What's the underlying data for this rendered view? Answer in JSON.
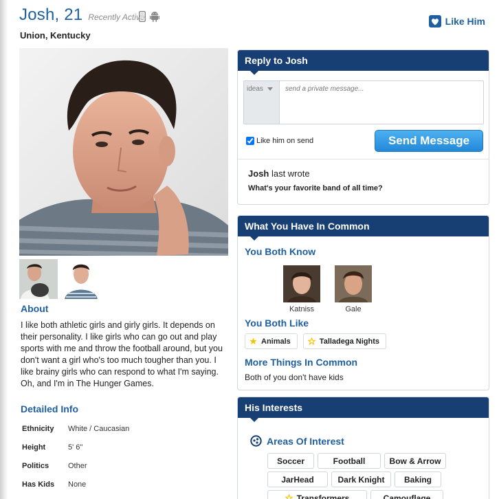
{
  "profile": {
    "name": "Josh, 21",
    "activity": "Recently Active",
    "location": "Union, Kentucky",
    "like_label": "Like Him"
  },
  "about": {
    "title": "About",
    "text": "I like both athletic girls and girly girls. It depends on their personality. I like girls who can go out and play sports with me and throw the football around, but you don't want a girl who's too much tougher than you. I like brainy girls who can respond to what I'm saying. Oh, and I'm in The Hunger Games."
  },
  "details": {
    "title": "Detailed Info",
    "rows": [
      {
        "key": "Ethnicity",
        "value": "White / Caucasian"
      },
      {
        "key": "Height",
        "value": "5' 6\""
      },
      {
        "key": "Politics",
        "value": "Other"
      },
      {
        "key": "Has Kids",
        "value": "None"
      }
    ]
  },
  "reply": {
    "title": "Reply to Josh",
    "ideas_label": "ideas",
    "placeholder": "send a private message...",
    "like_on_send": "Like him on send",
    "send_label": "Send Message",
    "last_wrote_name": "Josh",
    "last_wrote_suffix": " last wrote",
    "last_message": "What's your favorite band of all time?"
  },
  "common": {
    "title": "What You Have In Common",
    "know_title": "You Both Know",
    "friends": [
      "Katniss",
      "Gale"
    ],
    "like_title": "You Both Like",
    "likes": [
      "Animals",
      "Talladega Nights"
    ],
    "more_title": "More Things In Common",
    "more_text": "Both of you don't have kids"
  },
  "interests": {
    "title": "His Interests",
    "area_title": "Areas Of Interest",
    "tags": [
      "Soccer",
      "Football",
      "Bow & Arrow",
      "JarHead",
      "Dark Knight",
      "Baking",
      "Transformers",
      "Camouflage"
    ]
  },
  "colors": {
    "brand_blue": "#1f5fa0",
    "panel_header": "#173f73",
    "send_button": "#2389d8",
    "star": "#f5c400"
  }
}
